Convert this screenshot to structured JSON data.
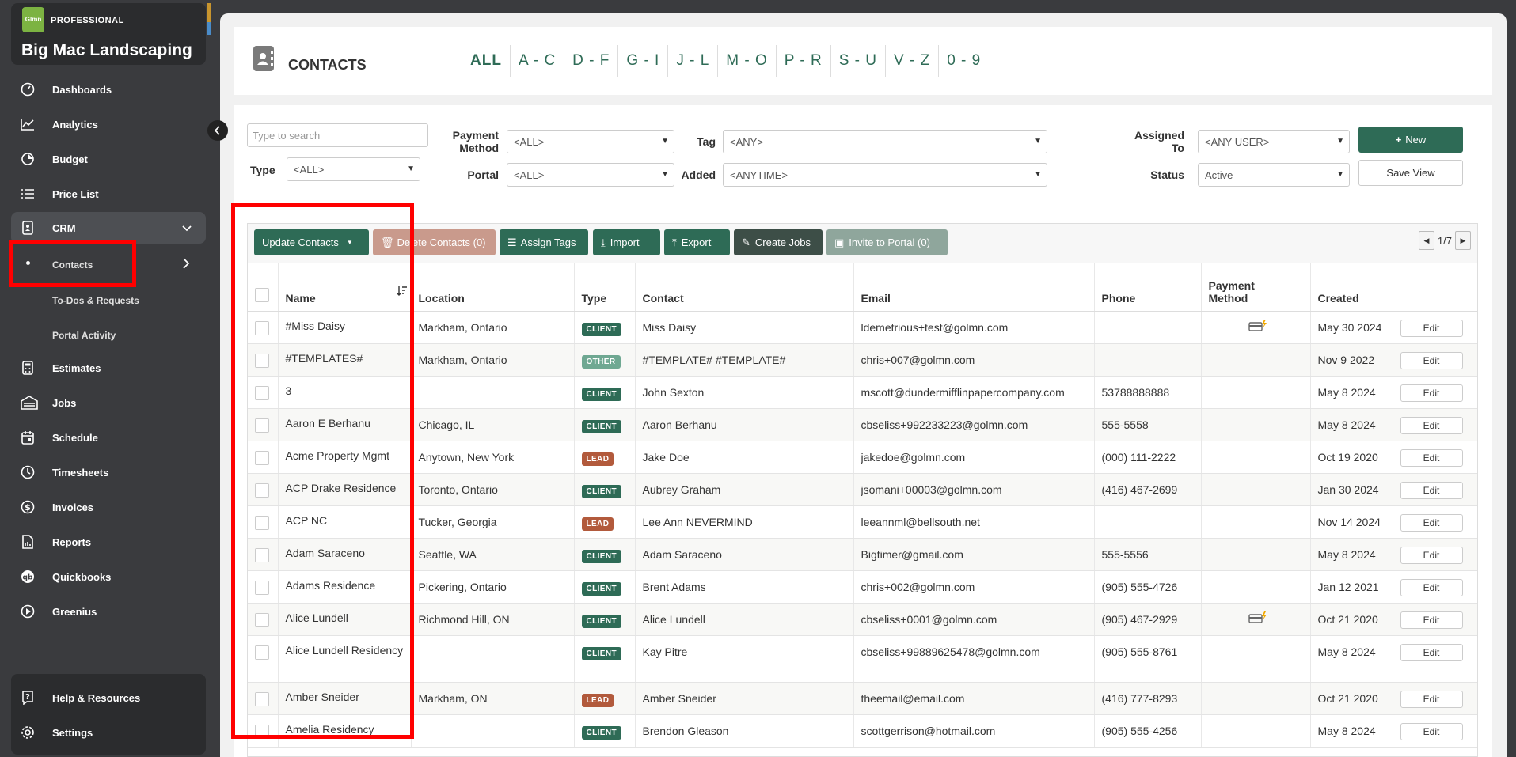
{
  "brand": {
    "logo": "Glmn",
    "tier": "PROFESSIONAL",
    "name": "Big Mac Landscaping"
  },
  "nav": {
    "items": [
      {
        "label": "Dashboards",
        "icon": "gauge-icon"
      },
      {
        "label": "Analytics",
        "icon": "line-chart-icon"
      },
      {
        "label": "Budget",
        "icon": "pie-chart-icon"
      },
      {
        "label": "Price List",
        "icon": "list-icon"
      },
      {
        "label": "CRM",
        "icon": "contact-card-icon"
      },
      {
        "label": "Estimates",
        "icon": "calculator-icon"
      },
      {
        "label": "Jobs",
        "icon": "building-icon"
      },
      {
        "label": "Schedule",
        "icon": "calendar-icon"
      },
      {
        "label": "Timesheets",
        "icon": "clock-icon"
      },
      {
        "label": "Invoices",
        "icon": "dollar-icon"
      },
      {
        "label": "Reports",
        "icon": "report-icon"
      },
      {
        "label": "Quickbooks",
        "icon": "quickbooks-icon"
      },
      {
        "label": "Greenius",
        "icon": "play-circle-icon"
      }
    ],
    "crm_sub": [
      "Contacts",
      "To-Dos & Requests",
      "Portal Activity"
    ],
    "bottom": [
      {
        "label": "Help & Resources",
        "icon": "help-icon"
      },
      {
        "label": "Settings",
        "icon": "gear-icon"
      }
    ]
  },
  "header": {
    "title": "CONTACTS",
    "alpha": [
      "ALL",
      "A - C",
      "D - F",
      "G - I",
      "J - L",
      "M - O",
      "P - R",
      "S - U",
      "V - Z",
      "0 - 9"
    ]
  },
  "filters": {
    "search_placeholder": "Type to search",
    "type_label": "Type",
    "type_value": "<ALL>",
    "payment_label_1": "Payment",
    "payment_label_2": "Method",
    "payment_value": "<ALL>",
    "portal_label": "Portal",
    "portal_value": "<ALL>",
    "tag_label": "Tag",
    "tag_value": "<ANY>",
    "added_label": "Added",
    "added_value": "<ANYTIME>",
    "assigned_label_1": "Assigned",
    "assigned_label_2": "To",
    "assigned_value": "<ANY USER>",
    "status_label": "Status",
    "status_value": "Active",
    "new_label": "New",
    "save_view_label": "Save View"
  },
  "toolbar": {
    "update": "Update Contacts",
    "delete": "Delete Contacts (0)",
    "assign_tags": "Assign Tags",
    "import": "Import",
    "export": "Export",
    "create_jobs": "Create Jobs",
    "invite": "Invite to Portal (0)",
    "page": "1/7"
  },
  "table": {
    "columns": {
      "name": "Name",
      "location": "Location",
      "type": "Type",
      "contact": "Contact",
      "email": "Email",
      "phone": "Phone",
      "payment_1": "Payment",
      "payment_2": "Method",
      "created": "Created"
    },
    "edit_label": "Edit",
    "rows": [
      {
        "name": "#Miss Daisy",
        "location": "Markham, Ontario",
        "type": "CLIENT",
        "contact": "Miss Daisy",
        "email": "ldemetrious+test@golmn.com",
        "phone": "",
        "pay": true,
        "created": "May 30 2024"
      },
      {
        "name": "#TEMPLATES#",
        "location": "Markham, Ontario",
        "type": "OTHER",
        "contact": "#TEMPLATE# #TEMPLATE#",
        "email": "chris+007@golmn.com",
        "phone": "",
        "pay": false,
        "created": "Nov 9 2022"
      },
      {
        "name": "3",
        "location": "",
        "type": "CLIENT",
        "contact": "John Sexton",
        "email": "mscott@dundermifflinpapercompany.com",
        "phone": "53788888888",
        "pay": false,
        "created": "May 8 2024"
      },
      {
        "name": "Aaron E Berhanu",
        "location": "Chicago, IL",
        "type": "CLIENT",
        "contact": "Aaron Berhanu",
        "email": "cbseliss+992233223@golmn.com",
        "phone": "555-5558",
        "pay": false,
        "created": "May 8 2024"
      },
      {
        "name": "Acme Property Mgmt",
        "location": "Anytown, New York",
        "type": "LEAD",
        "contact": "Jake Doe",
        "email": "jakedoe@golmn.com",
        "phone": "(000) 111-2222",
        "pay": false,
        "created": "Oct 19 2020"
      },
      {
        "name": "ACP Drake Residence",
        "location": "Toronto, Ontario",
        "type": "CLIENT",
        "contact": "Aubrey Graham",
        "email": "jsomani+00003@golmn.com",
        "phone": "(416) 467-2699",
        "pay": false,
        "created": "Jan 30 2024"
      },
      {
        "name": "ACP NC",
        "location": "Tucker, Georgia",
        "type": "LEAD",
        "contact": "Lee Ann NEVERMIND",
        "email": "leeannml@bellsouth.net",
        "phone": "",
        "pay": false,
        "created": "Nov 14 2024"
      },
      {
        "name": "Adam Saraceno",
        "location": "Seattle, WA",
        "type": "CLIENT",
        "contact": "Adam Saraceno",
        "email": "Bigtimer@gmail.com",
        "phone": "555-5556",
        "pay": false,
        "created": "May 8 2024"
      },
      {
        "name": "Adams Residence",
        "location": "Pickering, Ontario",
        "type": "CLIENT",
        "contact": "Brent Adams",
        "email": "chris+002@golmn.com",
        "phone": "(905) 555-4726",
        "pay": false,
        "created": "Jan 12 2021"
      },
      {
        "name": "Alice Lundell",
        "location": "Richmond Hill, ON",
        "type": "CLIENT",
        "contact": "Alice Lundell",
        "email": "cbseliss+0001@golmn.com",
        "phone": "(905) 467-2929",
        "pay": true,
        "created": "Oct 21 2020"
      },
      {
        "name": "Alice Lundell Residency",
        "location": "",
        "type": "CLIENT",
        "contact": "Kay Pitre",
        "email": "cbseliss+99889625478@golmn.com",
        "phone": "(905) 555-8761",
        "pay": false,
        "created": "May 8 2024"
      },
      {
        "name": "Amber Sneider",
        "location": "Markham, ON",
        "type": "LEAD",
        "contact": "Amber Sneider",
        "email": "theemail@email.com",
        "phone": "(416) 777-8293",
        "pay": false,
        "created": "Oct 21 2020"
      },
      {
        "name": "Amelia Residency",
        "location": "",
        "type": "CLIENT",
        "contact": "Brendon Gleason",
        "email": "scottgerrison@hotmail.com",
        "phone": "(905) 555-4256",
        "pay": false,
        "created": "May 8 2024"
      }
    ]
  },
  "colors": {
    "accent": "#2e6b56",
    "lead": "#b25a3c",
    "other": "#6fa892",
    "highlight": "#ff0000"
  }
}
